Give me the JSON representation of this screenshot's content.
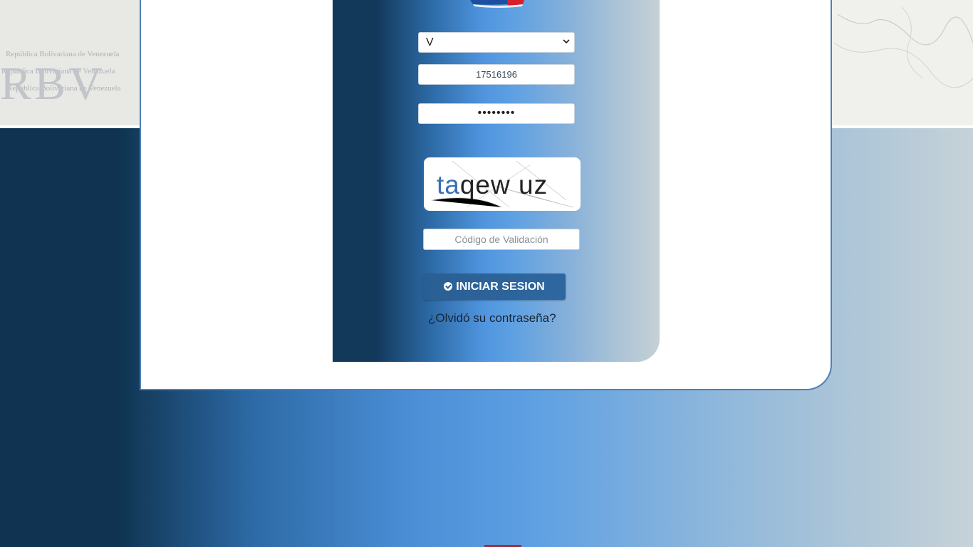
{
  "background": {
    "watermark": {
      "big": "RBV",
      "lines": [
        "República Bolivariana de Venezuela",
        "República Bolivariana de Venezuela",
        "República Bolivariana de Venezuela"
      ]
    }
  },
  "login": {
    "document_type": "V",
    "id_value": "17516196",
    "password_mask": "••••••••",
    "captcha": {
      "text_colored": "ta",
      "text_rest": "qew uz"
    },
    "code_placeholder": "Código de Validación",
    "submit_label": "INICIAR SESION",
    "forgot_label": "¿Olvidó su contraseña?"
  },
  "colors": {
    "card_border": "#4f7fb6",
    "button": "#2a5f93",
    "panel_dark": "#12385a",
    "panel_mid": "#5ea0e2",
    "panel_light": "#c5d1d5"
  }
}
